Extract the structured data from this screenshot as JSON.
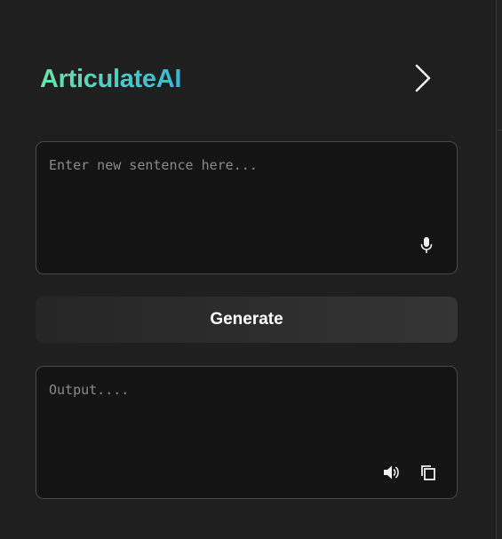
{
  "header": {
    "title": "ArticulateAI",
    "collapse_icon": "chevron-right-icon"
  },
  "input": {
    "value": "",
    "placeholder": "Enter new sentence here...",
    "mic_icon": "microphone-icon"
  },
  "actions": {
    "generate_label": "Generate"
  },
  "output": {
    "value": "",
    "placeholder": "Output....",
    "speaker_icon": "speaker-icon",
    "copy_icon": "copy-icon"
  },
  "colors": {
    "background": "#1f1f1f",
    "field_background": "#141414",
    "field_border": "#4a4a4a",
    "title_gradient_start": "#6fe3a6",
    "title_gradient_end": "#3bb7d6",
    "button_background": "#2e2e2e",
    "placeholder_text": "#8a8a8a"
  }
}
